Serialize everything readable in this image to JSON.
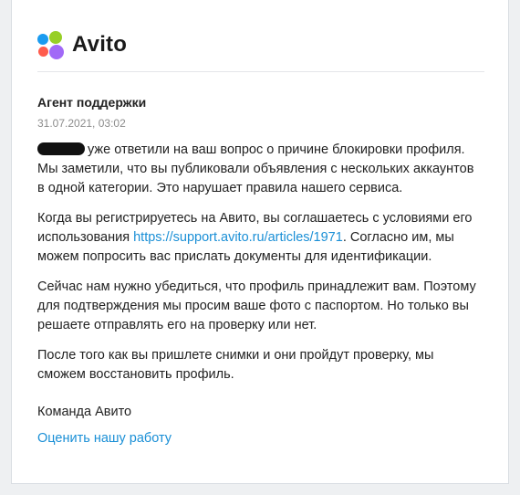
{
  "brand": {
    "name": "Avito",
    "dot_colors": [
      "#1a9bf0",
      "#97cf26",
      "#ff5c4d",
      "#a169f7"
    ]
  },
  "message": {
    "sender": "Агент поддержки",
    "date": "31.07.2021, 03:02",
    "paragraphs": {
      "p1": "уже ответили на ваш вопрос о причине блокировки профиля. Мы заметили, что вы публиковали объявления с нескольких аккаунтов в одной категории. Это нарушает правила нашего сервиса.",
      "p2_before": "Когда вы регистрируетесь на Авито, вы соглашаетесь с условиями его использования ",
      "p2_link": "https://support.avito.ru/articles/1971",
      "p2_after": ". Согласно им, мы можем попросить вас прислать документы для идентификации.",
      "p3": "Сейчас нам нужно убедиться, что профиль принадлежит вам. Поэтому для подтверждения мы просим ваше фото с паспортом. Но только вы решаете отправлять его на проверку или нет.",
      "p4": "После того как вы пришлете снимки и они пройдут проверку, мы сможем восстановить профиль."
    },
    "signature": "Команда Авито",
    "rate_link": "Оценить нашу работу"
  }
}
